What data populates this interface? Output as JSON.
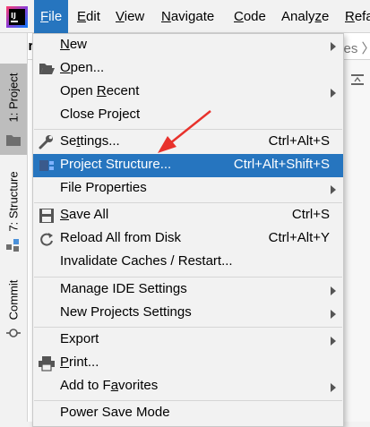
{
  "menubar": {
    "items": [
      {
        "label": "File",
        "mnemonic": "F",
        "rest": "ile"
      },
      {
        "label": "Edit",
        "mnemonic": "E",
        "rest": "dit"
      },
      {
        "label": "View",
        "mnemonic": "V",
        "rest": "iew"
      },
      {
        "label": "Navigate",
        "mnemonic": "N",
        "rest": "avigate"
      },
      {
        "label": "Code",
        "mnemonic": "C",
        "rest": "ode"
      },
      {
        "label": "Analyze",
        "pre": "Analy",
        "mnemonic": "z",
        "rest": "e"
      },
      {
        "label": "Refa",
        "mnemonic": "R",
        "rest": "efa"
      }
    ]
  },
  "project": {
    "name": "vhr",
    "crumb": "ces 〉"
  },
  "left_strip": {
    "project_tab": "1: Project",
    "structure_tab": "7: Structure",
    "commit_tab": "Commit"
  },
  "file_menu": {
    "new": {
      "pre": "",
      "mn": "N",
      "post": "ew"
    },
    "open": {
      "pre": "",
      "mn": "O",
      "post": "pen..."
    },
    "open_recent": {
      "pre": "Open ",
      "mn": "R",
      "post": "ecent"
    },
    "close_project": {
      "label": "Close Project"
    },
    "settings": {
      "pre": "Se",
      "mn": "t",
      "post": "tings...",
      "shortcut": "Ctrl+Alt+S"
    },
    "project_structure": {
      "label": "Project Structure...",
      "shortcut": "Ctrl+Alt+Shift+S"
    },
    "file_properties": {
      "label": "File Properties"
    },
    "save_all": {
      "pre": "",
      "mn": "S",
      "post": "ave All",
      "shortcut": "Ctrl+S"
    },
    "reload": {
      "label": "Reload All from Disk",
      "shortcut": "Ctrl+Alt+Y"
    },
    "invalidate": {
      "label": "Invalidate Caches / Restart..."
    },
    "manage_ide": {
      "label": "Manage IDE Settings"
    },
    "new_projects_settings": {
      "label": "New Projects Settings"
    },
    "export": {
      "label": "Export"
    },
    "print": {
      "pre": "",
      "mn": "P",
      "post": "rint..."
    },
    "add_favorites": {
      "pre": "Add to F",
      "mn": "a",
      "post": "vorites"
    },
    "power_save": {
      "label": "Power Save Mode"
    }
  },
  "colors": {
    "highlight": "#2675bf",
    "arrow": "#e8322c",
    "menu_bg": "#f2f2f2"
  }
}
